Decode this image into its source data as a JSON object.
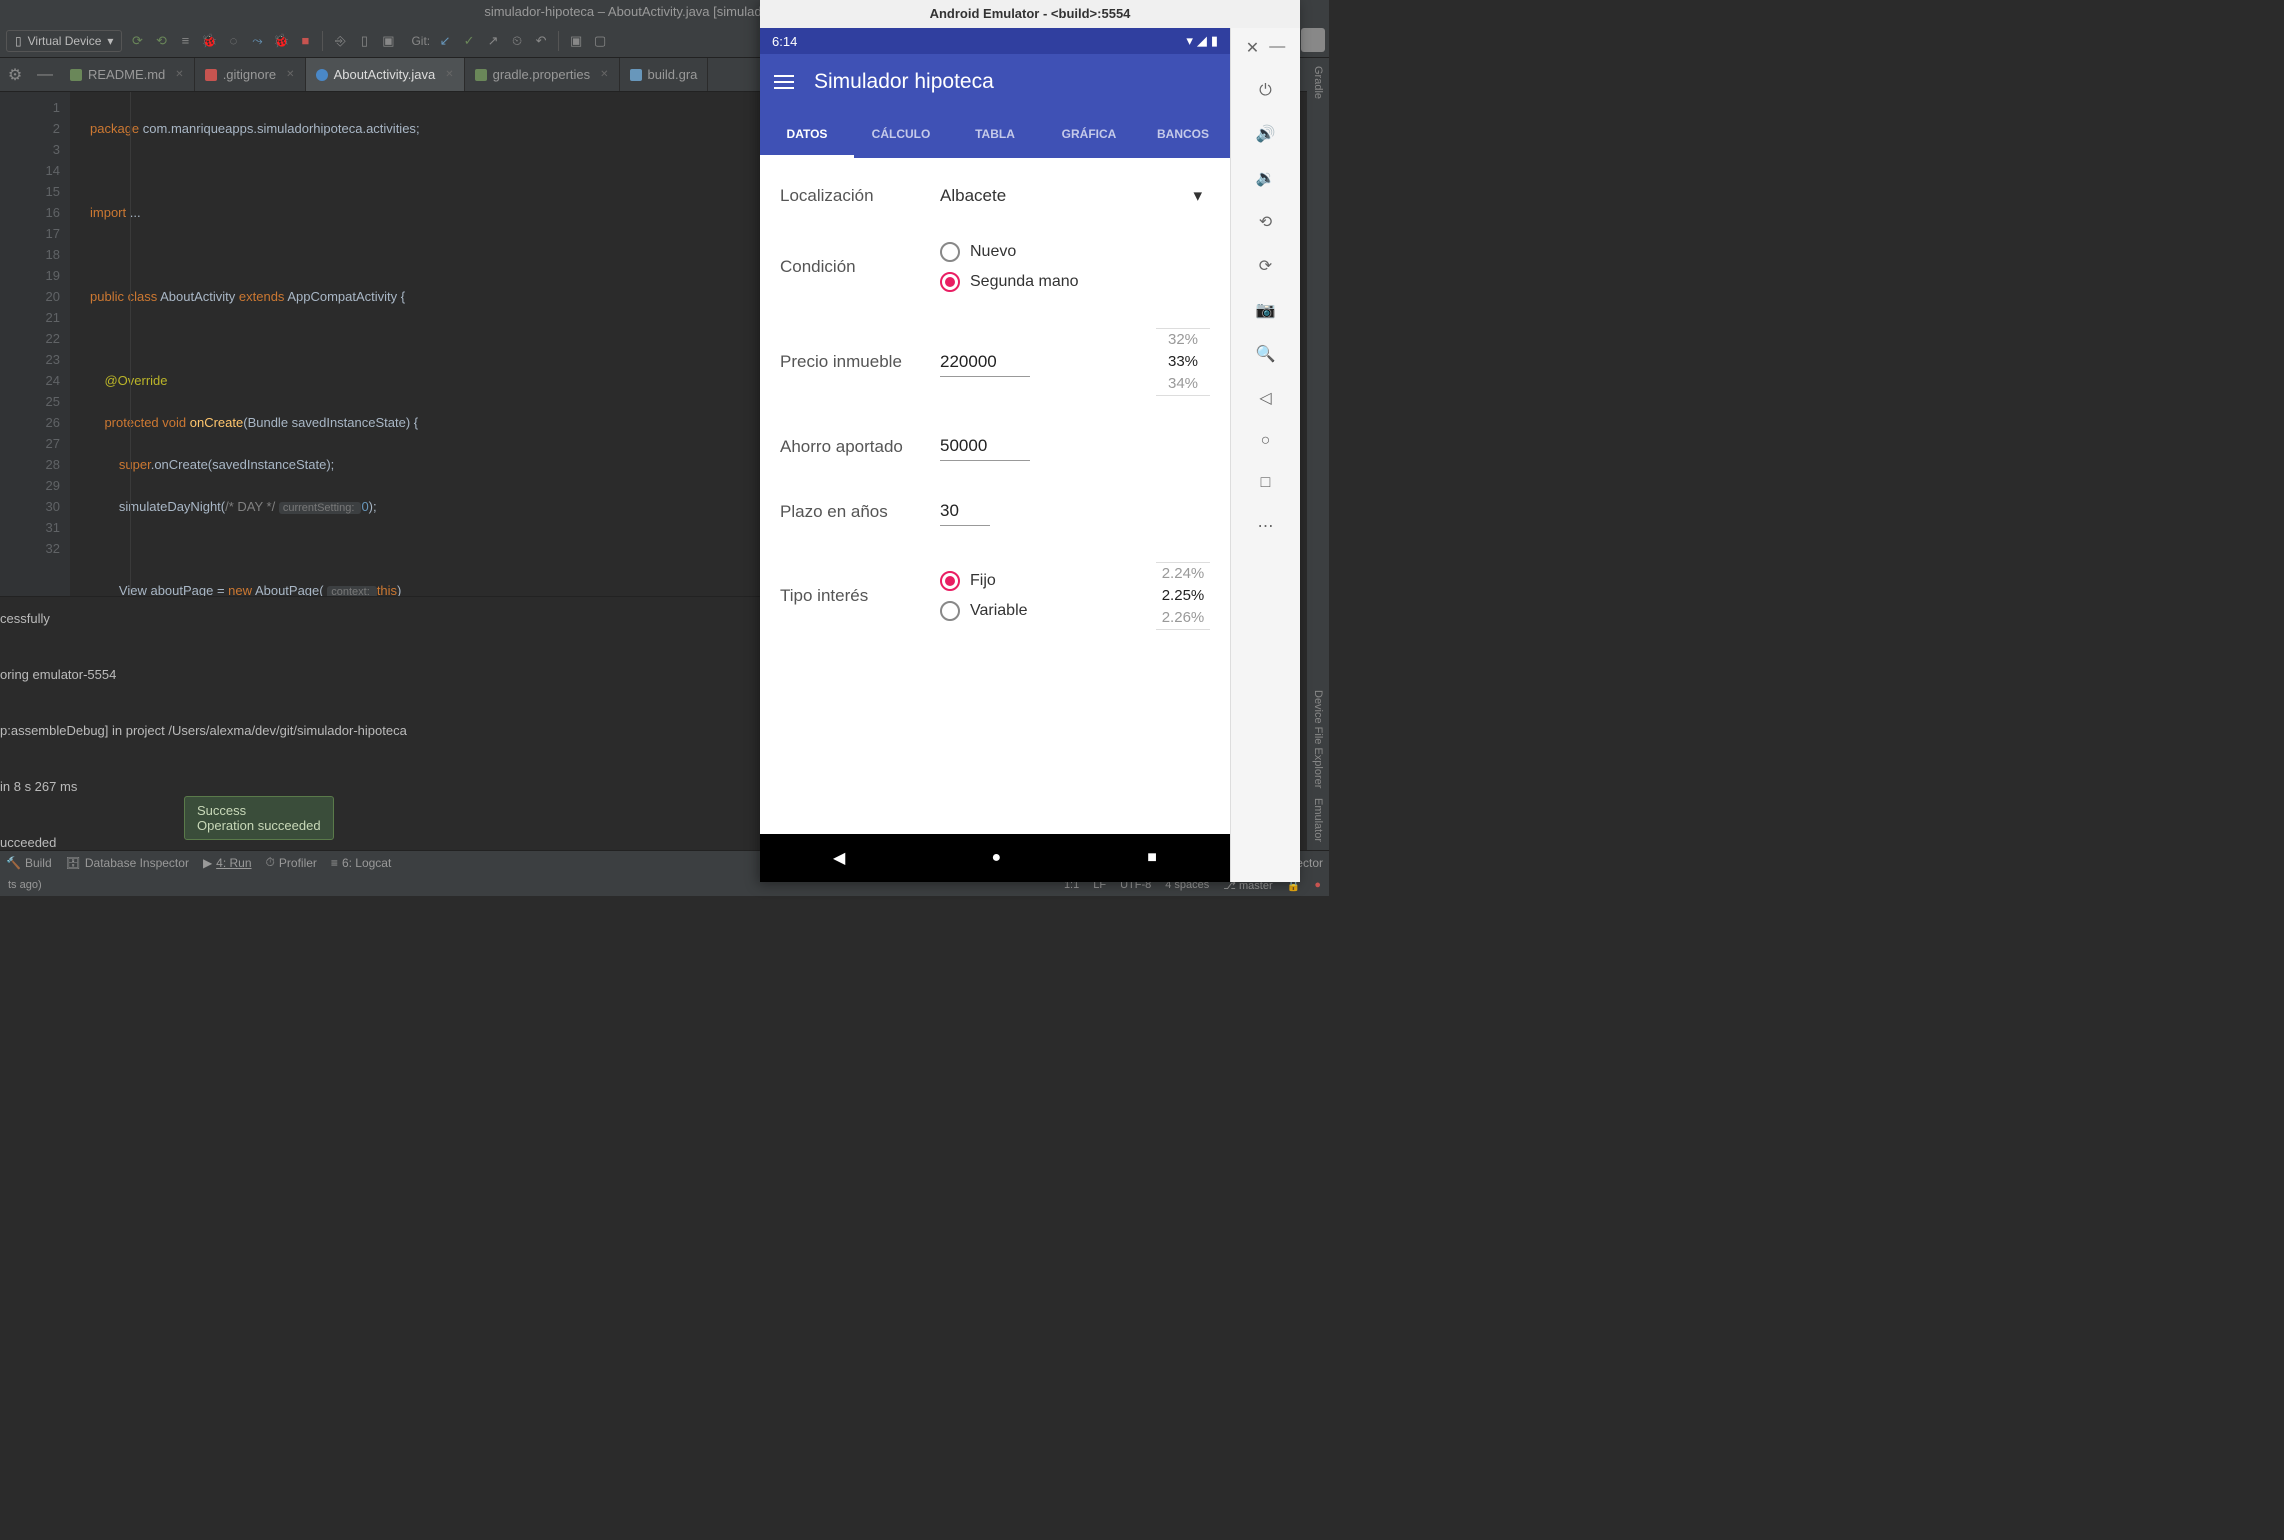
{
  "window_title": "simulador-hipoteca – AboutActivity.java [simulador-hipoteca.ap",
  "device_selector": "Virtual Device",
  "git_label": "Git:",
  "file_tabs": [
    {
      "name": "README.md",
      "icon": "md"
    },
    {
      "name": ".gitignore",
      "icon": "git"
    },
    {
      "name": "AboutActivity.java",
      "icon": "java",
      "active": true
    },
    {
      "name": "gradle.properties",
      "icon": "gradle"
    },
    {
      "name": "build.gra",
      "icon": "build"
    }
  ],
  "line_numbers": [
    "1",
    "2",
    "3",
    "14",
    "15",
    "16",
    "17",
    "18",
    "19",
    "20",
    "21",
    "22",
    "23",
    "24",
    "25",
    "26",
    "27",
    "28",
    "29",
    "30",
    "31",
    "32"
  ],
  "console_lines": [
    "cessfully",
    "",
    "oring emulator-5554",
    "",
    "p:assembleDebug] in project /Users/alexma/dev/git/simulador-hipoteca",
    "",
    " in 8 s 267 ms",
    "",
    "ucceeded"
  ],
  "tooltip": {
    "line1": "Success",
    "line2": "Operation succeeded"
  },
  "bottom_tools": {
    "build": "Build",
    "db": "Database Inspector",
    "run": "4: Run",
    "profiler": "Profiler",
    "logcat": "6: Logcat",
    "inspector": "inspector"
  },
  "status_left": "ts ago)",
  "status": {
    "pos": "1:1",
    "lf": "LF",
    "enc": "UTF-8",
    "indent": "4 spaces",
    "branch": "master"
  },
  "right_tools": [
    "Gradle",
    "Device File Explorer",
    "Emulator"
  ],
  "emulator_title": "Android Emulator - <build>:5554",
  "phone": {
    "clock": "6:14",
    "app_title": "Simulador hipoteca",
    "tabs": [
      "DATOS",
      "CÁLCULO",
      "TABLA",
      "GRÁFICA",
      "BANCOS"
    ],
    "form": {
      "loc_label": "Localización",
      "loc_value": "Albacete",
      "cond_label": "Condición",
      "cond_opt1": "Nuevo",
      "cond_opt2": "Segunda mano",
      "price_label": "Precio inmueble",
      "price_value": "220000",
      "price_pct": [
        "32%",
        "33%",
        "34%"
      ],
      "savings_label": "Ahorro aportado",
      "savings_value": "50000",
      "years_label": "Plazo en años",
      "years_value": "30",
      "interest_label": "Tipo interés",
      "interest_opt1": "Fijo",
      "interest_opt2": "Variable",
      "interest_pct": [
        "2.24%",
        "2.25%",
        "2.26%"
      ]
    }
  }
}
